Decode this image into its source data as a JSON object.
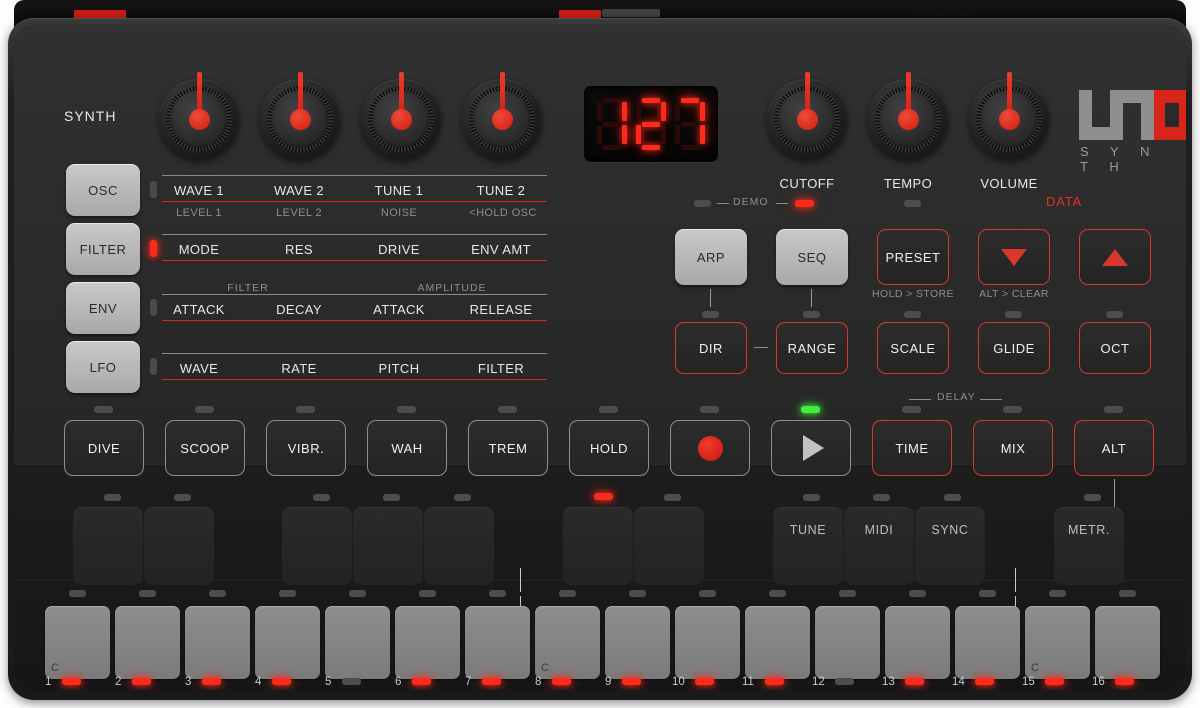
{
  "device": {
    "brand_logo": "uno-logo",
    "brand_sub": "S Y N T H",
    "section_label": "SYNTH"
  },
  "display": {
    "value": "127",
    "digits": [
      "1",
      "2",
      "7"
    ]
  },
  "knobs": {
    "synth": [
      {
        "label": "WAVE 1",
        "sub": "LEVEL 1"
      },
      {
        "label": "WAVE 2",
        "sub": "LEVEL 2"
      },
      {
        "label": "TUNE 1",
        "sub": "NOISE"
      },
      {
        "label": "TUNE 2",
        "sub": "<HOLD OSC"
      }
    ],
    "master": [
      {
        "label": "CUTOFF"
      },
      {
        "label": "TEMPO"
      },
      {
        "label": "VOLUME"
      }
    ]
  },
  "mode_buttons": [
    {
      "label": "OSC",
      "led": "off"
    },
    {
      "label": "FILTER",
      "led": "on"
    },
    {
      "label": "ENV",
      "led": "off"
    },
    {
      "label": "LFO",
      "led": "off"
    }
  ],
  "param_rows": [
    {
      "group_left": "",
      "group_right": "",
      "params": [
        "WAVE 1",
        "WAVE 2",
        "TUNE 1",
        "TUNE 2"
      ],
      "subs": [
        "LEVEL 1",
        "LEVEL 2",
        "NOISE",
        "<HOLD OSC"
      ]
    },
    {
      "group_left": "",
      "group_right": "",
      "params": [
        "MODE",
        "RES",
        "DRIVE",
        "ENV AMT"
      ],
      "subs": [
        "",
        "",
        "",
        ""
      ]
    },
    {
      "group_left": "FILTER",
      "group_right": "AMPLITUDE",
      "params": [
        "ATTACK",
        "DECAY",
        "ATTACK",
        "RELEASE"
      ],
      "subs": [
        "",
        "",
        "",
        ""
      ]
    },
    {
      "group_left": "",
      "group_right": "",
      "params": [
        "WAVE",
        "RATE",
        "PITCH",
        "FILTER"
      ],
      "subs": [
        "",
        "",
        "",
        ""
      ]
    }
  ],
  "sequencer": {
    "demo_label": "DEMO",
    "demo_led": "on",
    "data_label": "DATA",
    "row1": [
      {
        "label": "ARP",
        "style": "gray",
        "led": "off"
      },
      {
        "label": "SEQ",
        "style": "gray",
        "led": "off"
      },
      {
        "label": "PRESET",
        "style": "outred",
        "led": "off",
        "sub": "HOLD > STORE"
      },
      {
        "label": "▼",
        "style": "outred",
        "icon": "triangle-down",
        "sub": "ALT > CLEAR"
      },
      {
        "label": "▲",
        "style": "outred",
        "icon": "triangle-up"
      }
    ],
    "row2": [
      {
        "label": "DIR",
        "style": "outred",
        "led": "off"
      },
      {
        "label": "RANGE",
        "style": "outred",
        "led": "off"
      },
      {
        "label": "SCALE",
        "style": "outred",
        "led": "off"
      },
      {
        "label": "GLIDE",
        "style": "outred",
        "led": "off"
      },
      {
        "label": "OCT",
        "style": "outred",
        "led": "off"
      }
    ]
  },
  "performance": {
    "delay_label": "DELAY",
    "buttons": [
      {
        "label": "DIVE",
        "style": "outgray",
        "led": "off"
      },
      {
        "label": "SCOOP",
        "style": "outgray",
        "led": "off"
      },
      {
        "label": "VIBR.",
        "style": "outgray",
        "led": "off"
      },
      {
        "label": "WAH",
        "style": "outgray",
        "led": "off"
      },
      {
        "label": "TREM",
        "style": "outgray",
        "led": "off"
      },
      {
        "label": "HOLD",
        "style": "outgray",
        "led": "off"
      },
      {
        "label": "",
        "style": "outgray",
        "led": "off",
        "icon": "record-dot"
      },
      {
        "label": "",
        "style": "outgray",
        "led": "green",
        "icon": "play-triangle"
      },
      {
        "label": "TIME",
        "style": "outred",
        "led": "off"
      },
      {
        "label": "MIX",
        "style": "outred",
        "led": "off"
      },
      {
        "label": "ALT",
        "style": "outred",
        "led": "off"
      }
    ]
  },
  "pads": [
    {
      "label": "",
      "led": "off",
      "group": "black"
    },
    {
      "label": "",
      "led": "off",
      "group": "black"
    },
    {
      "label": "",
      "led": "off",
      "group": "black"
    },
    {
      "label": "",
      "led": "off",
      "group": "black"
    },
    {
      "label": "",
      "led": "off",
      "group": "black"
    },
    {
      "label": "",
      "led": "red",
      "group": "black"
    },
    {
      "label": "",
      "led": "off",
      "group": "black"
    },
    {
      "label": "TUNE",
      "led": "off",
      "group": "function"
    },
    {
      "label": "MIDI",
      "led": "off",
      "group": "function"
    },
    {
      "label": "SYNC",
      "led": "off",
      "group": "function"
    },
    {
      "label": "METR.",
      "led": "off",
      "group": "function"
    }
  ],
  "keys": [
    {
      "num": "1",
      "note": "C",
      "led": "red"
    },
    {
      "num": "2",
      "note": "",
      "led": "red"
    },
    {
      "num": "3",
      "note": "",
      "led": "red"
    },
    {
      "num": "4",
      "note": "",
      "led": "red"
    },
    {
      "num": "5",
      "note": "",
      "led": "off"
    },
    {
      "num": "6",
      "note": "",
      "led": "red"
    },
    {
      "num": "7",
      "note": "",
      "led": "red"
    },
    {
      "num": "8",
      "note": "C",
      "led": "red"
    },
    {
      "num": "9",
      "note": "",
      "led": "red"
    },
    {
      "num": "10",
      "note": "",
      "led": "red"
    },
    {
      "num": "11",
      "note": "",
      "led": "red"
    },
    {
      "num": "12",
      "note": "",
      "led": "off"
    },
    {
      "num": "13",
      "note": "",
      "led": "red"
    },
    {
      "num": "14",
      "note": "",
      "led": "red"
    },
    {
      "num": "15",
      "note": "C",
      "led": "red"
    },
    {
      "num": "16",
      "note": "",
      "led": "red"
    }
  ]
}
